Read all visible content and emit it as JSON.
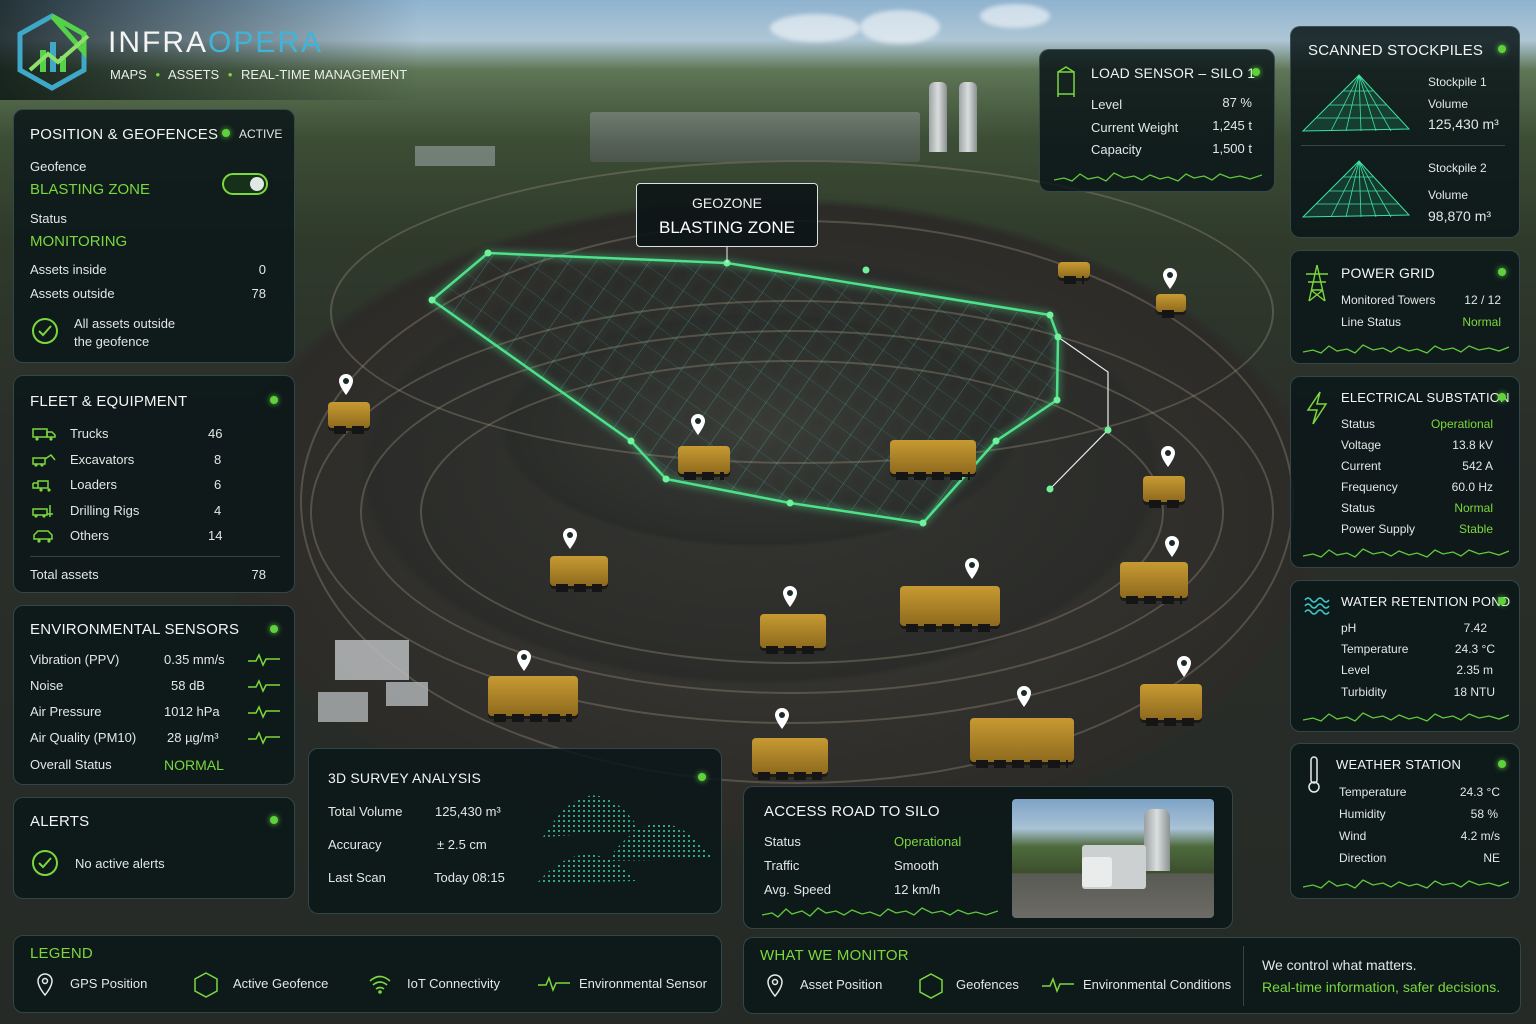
{
  "brand": {
    "name_a": "INFRA",
    "name_b": "OPERA",
    "tagline_1": "MAPS",
    "tagline_2": "ASSETS",
    "tagline_3": "REAL-TIME MANAGEMENT"
  },
  "geozone": {
    "label": "GEOZONE",
    "name": "BLASTING ZONE"
  },
  "position": {
    "title": "POSITION & GEOFENCES",
    "state": "ACTIVE",
    "geofence_label": "Geofence",
    "geofence_value": "BLASTING ZONE",
    "toggle_on": true,
    "status_label": "Status",
    "status_value": "MONITORING",
    "inside_label": "Assets inside",
    "inside_value": "0",
    "outside_label": "Assets outside",
    "outside_value": "78",
    "note_1": "All assets outside",
    "note_2": "the geofence"
  },
  "fleet": {
    "title": "FLEET & EQUIPMENT",
    "items": [
      {
        "label": "Trucks",
        "value": "46",
        "icon": "truck-icon"
      },
      {
        "label": "Excavators",
        "value": "8",
        "icon": "excavator-icon"
      },
      {
        "label": "Loaders",
        "value": "6",
        "icon": "loader-icon"
      },
      {
        "label": "Drilling Rigs",
        "value": "4",
        "icon": "drilling-rig-icon"
      },
      {
        "label": "Others",
        "value": "14",
        "icon": "vehicle-icon"
      }
    ],
    "total_label": "Total assets",
    "total_value": "78"
  },
  "env": {
    "title": "ENVIRONMENTAL SENSORS",
    "rows": [
      {
        "label": "Vibration (PPV)",
        "value": "0.35 mm/s"
      },
      {
        "label": "Noise",
        "value": "58 dB"
      },
      {
        "label": "Air Pressure",
        "value": "1012 hPa"
      },
      {
        "label": "Air Quality (PM10)",
        "value": "28 µg/m³"
      }
    ],
    "overall_label": "Overall Status",
    "overall_value": "NORMAL"
  },
  "alerts": {
    "title": "ALERTS",
    "message": "No active alerts"
  },
  "survey": {
    "title": "3D SURVEY ANALYSIS",
    "rows": [
      {
        "label": "Total Volume",
        "value": "125,430 m³"
      },
      {
        "label": "Accuracy",
        "value": "± 2.5 cm"
      },
      {
        "label": "Last Scan",
        "value": "Today 08:15"
      }
    ]
  },
  "access_road": {
    "title": "ACCESS ROAD TO SILO",
    "rows": [
      {
        "label": "Status",
        "value": "Operational"
      },
      {
        "label": "Traffic",
        "value": "Smooth"
      },
      {
        "label": "Avg. Speed",
        "value": "12 km/h"
      }
    ]
  },
  "load_sensor": {
    "title": "LOAD SENSOR – SILO 1",
    "rows": [
      {
        "label": "Level",
        "value": "87 %"
      },
      {
        "label": "Current Weight",
        "value": "1,245 t"
      },
      {
        "label": "Capacity",
        "value": "1,500 t"
      }
    ]
  },
  "stockpiles": {
    "title": "SCANNED STOCKPILES",
    "items": [
      {
        "name": "Stockpile 1",
        "label": "Volume",
        "value": "125,430 m³"
      },
      {
        "name": "Stockpile 2",
        "label": "Volume",
        "value": "98,870 m³"
      }
    ]
  },
  "power": {
    "title": "POWER GRID",
    "rows": [
      {
        "label": "Monitored Towers",
        "value": "12 / 12"
      },
      {
        "label": "Line Status",
        "value": "Normal"
      }
    ]
  },
  "substation": {
    "title": "ELECTRICAL SUBSTATION",
    "rows": [
      {
        "label": "Status",
        "value": "Operational"
      },
      {
        "label": "Voltage",
        "value": "13.8 kV"
      },
      {
        "label": "Current",
        "value": "542 A"
      },
      {
        "label": "Frequency",
        "value": "60.0 Hz"
      },
      {
        "label": "Status",
        "value": "Normal"
      },
      {
        "label": "Power Supply",
        "value": "Stable"
      }
    ]
  },
  "pond": {
    "title": "WATER RETENTION POND",
    "rows": [
      {
        "label": "pH",
        "value": "7.42"
      },
      {
        "label": "Temperature",
        "value": "24.3 °C"
      },
      {
        "label": "Level",
        "value": "2.35 m"
      },
      {
        "label": "Turbidity",
        "value": "18 NTU"
      }
    ]
  },
  "weather": {
    "title": "WEATHER STATION",
    "rows": [
      {
        "label": "Temperature",
        "value": "24.3 °C"
      },
      {
        "label": "Humidity",
        "value": "58 %"
      },
      {
        "label": "Wind",
        "value": "4.2 m/s"
      },
      {
        "label": "Direction",
        "value": "NE"
      }
    ]
  },
  "legend": {
    "title": "LEGEND",
    "items": [
      {
        "label": "GPS Position",
        "icon": "map-pin-icon"
      },
      {
        "label": "Active Geofence",
        "icon": "hexagon-icon"
      },
      {
        "label": "IoT Connectivity",
        "icon": "wifi-icon"
      },
      {
        "label": "Environmental Sensor",
        "icon": "pulse-icon"
      }
    ]
  },
  "monitor": {
    "title": "WHAT WE MONITOR",
    "items": [
      {
        "label": "Asset Position",
        "icon": "map-pin-icon"
      },
      {
        "label": "Geofences",
        "icon": "hexagon-icon"
      },
      {
        "label": "Environmental Conditions",
        "icon": "pulse-icon"
      }
    ],
    "slogan_1": "We control what matters.",
    "slogan_2": "Real-time information, safer decisions."
  },
  "colors": {
    "accent": "#7bd83c",
    "panel": "#0a1618",
    "geofence": "#4ee08a"
  }
}
